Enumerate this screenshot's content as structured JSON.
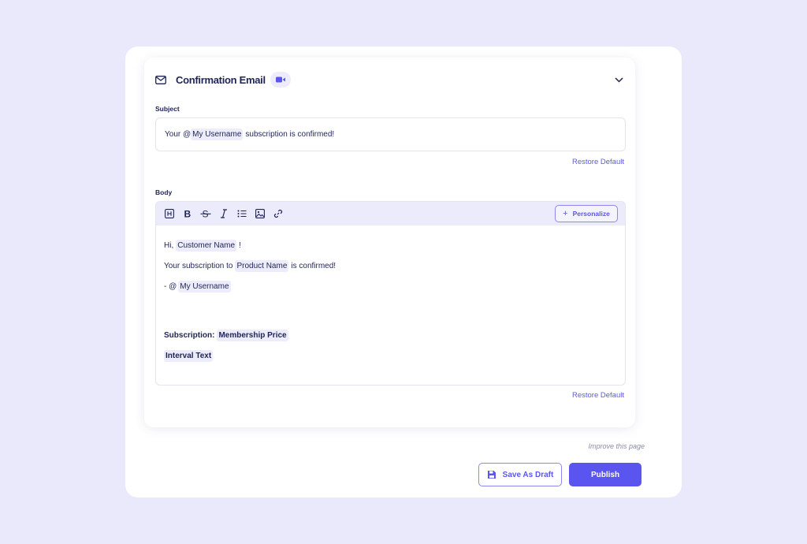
{
  "header": {
    "title": "Confirmation Email",
    "icon": "mail-icon",
    "badge_icon": "video-icon",
    "collapse_icon": "chevron-down-icon"
  },
  "subject": {
    "label": "Subject",
    "prefix": "Your @",
    "tag": "My Username",
    "suffix": "subscription is confirmed!",
    "restore_label": "Restore Default"
  },
  "body": {
    "label": "Body",
    "toolbar": {
      "buttons": [
        "heading-icon",
        "bold-icon",
        "strikethrough-icon",
        "italic-icon",
        "list-icon",
        "image-icon",
        "link-icon"
      ],
      "personalize_label": "Personalize"
    },
    "line1": {
      "prefix": "Hi,",
      "tag": "Customer Name",
      "suffix": "!"
    },
    "line2": {
      "prefix": "Your subscription to",
      "tag": "Product Name",
      "suffix": "is confirmed!"
    },
    "line3": {
      "prefix": "- @",
      "tag": "My Username"
    },
    "line4": {
      "prefix": "Subscription:",
      "tag": "Membership Price"
    },
    "line5": {
      "tag": "Interval Text"
    },
    "restore_label": "Restore Default"
  },
  "footer": {
    "improve_label": "Improve this page",
    "draft_label": "Save As Draft",
    "publish_label": "Publish"
  },
  "colors": {
    "accent": "#5b55f0",
    "background": "#e9e9fb",
    "tag_bg": "#ececfb",
    "text": "#1f2456"
  }
}
